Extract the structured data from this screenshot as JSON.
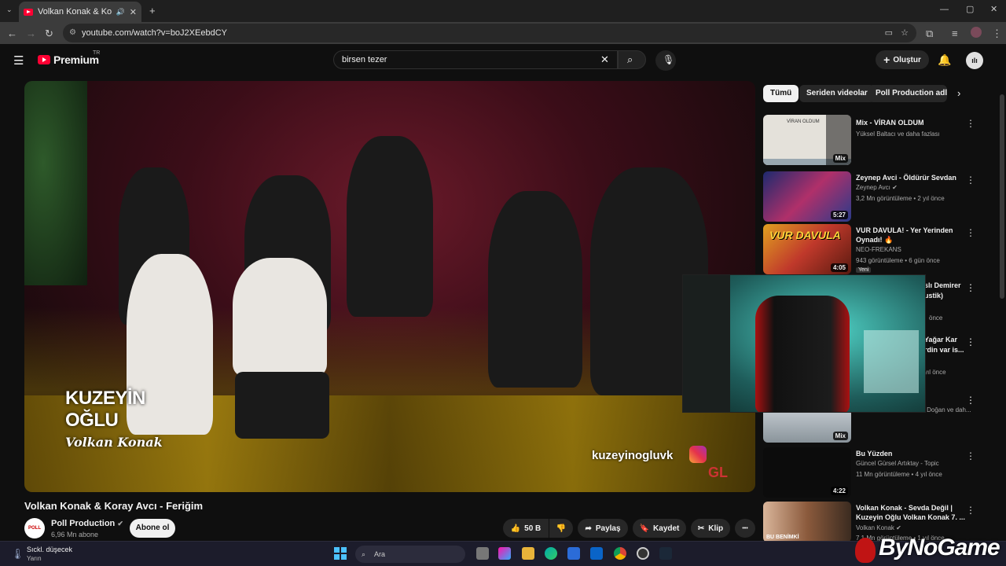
{
  "browser": {
    "tab_title": "Volkan Konak & Koray Avcı - Feri",
    "url": "youtube.com/watch?v=boJ2XEebdCY",
    "new_tab": "+"
  },
  "header": {
    "logo_text": "Premium",
    "country_code": "TR",
    "search_value": "birsen tezer",
    "create_label": "Oluştur",
    "avatar_text": "ılı"
  },
  "video": {
    "title": "Volkan Konak & Koray Avcı - Feriğim",
    "watermark_line1": "KUZEYİN",
    "watermark_line2": "OĞLU",
    "watermark_line3": "Volkan Konak",
    "handle": "kuzeyinogluvk",
    "corner_logo": "GL"
  },
  "channel": {
    "name": "Poll Production",
    "subscribers": "6,96 Mn abone",
    "subscribe_label": "Abone ol",
    "avatar_text": "POLL"
  },
  "actions": {
    "likes": "50 B",
    "share": "Paylaş",
    "save": "Kaydet",
    "clip": "Klip",
    "more": "•••"
  },
  "chips": [
    "Tümü",
    "Seriden videolar",
    "Poll Production adlı y"
  ],
  "recommendations": [
    {
      "title": "Mix - VİRAN OLDUM",
      "channel": "Yüksel Baltacı ve daha fazlası",
      "meta": "",
      "badge": "Mix",
      "thumb_text": "VİRAN OLDUM",
      "thumb_color": "#d8d4cc"
    },
    {
      "title": "Zeynep Avci - Öldürür Sevdan",
      "channel": "Zeynep Avcı",
      "meta": "3,2 Mn görüntüleme • 2 yıl önce",
      "badge": "5:27",
      "thumb_text": "",
      "thumb_color": "#2a3b8a"
    },
    {
      "title": "VUR DAVULA! - Yer Yerinden Oynadı! 🔥",
      "channel": "NEO-FREKANS",
      "meta": "943 görüntüleme • 6 gün önce",
      "badge": "4:05",
      "thumb_text": "VUR DAVULA",
      "thumb_color": "#c0392b",
      "tag": "Yeni"
    },
    {
      "title": "Bu Yüzden",
      "channel": "Güncel Gürsel Artıktay - Topic",
      "meta": "11 Mn görüntüleme • 4 yıl önce",
      "badge": "4:22",
      "thumb_text": "",
      "thumb_color": "#111111"
    },
    {
      "title": "Volkan Konak - Sevda Değil | Kuzeyin Oğlu Volkan Konak 7. ...",
      "channel": "Volkan Konak",
      "meta": "7,1 Mn görüntüleme • 1 yıl önce",
      "badge": "",
      "thumb_text": "BU BENİMKİ",
      "thumb_color": "#8b5a3c"
    }
  ],
  "partial_recs": {
    "r1_title": "slı Demirer",
    "r1_sub": "ustik)",
    "r1_meta": "önce",
    "r2_title": "Yağar Kar",
    "r2_sub": "rdin var is...",
    "r2_meta": "yıl önce",
    "r3_channel": "Yahan, Demirai, Ziv Bulu Doğan ve dah...",
    "r3_badge": "Mix"
  },
  "taskbar": {
    "weather_line1": "Sıckl. düşecek",
    "weather_line2": "Yarın",
    "search_placeholder": "Ara"
  },
  "overlay_brand": "ByNoGame",
  "colors": {
    "youtube_red": "#ff0033",
    "background": "#0f0f0f",
    "chip_bg": "#272727"
  }
}
